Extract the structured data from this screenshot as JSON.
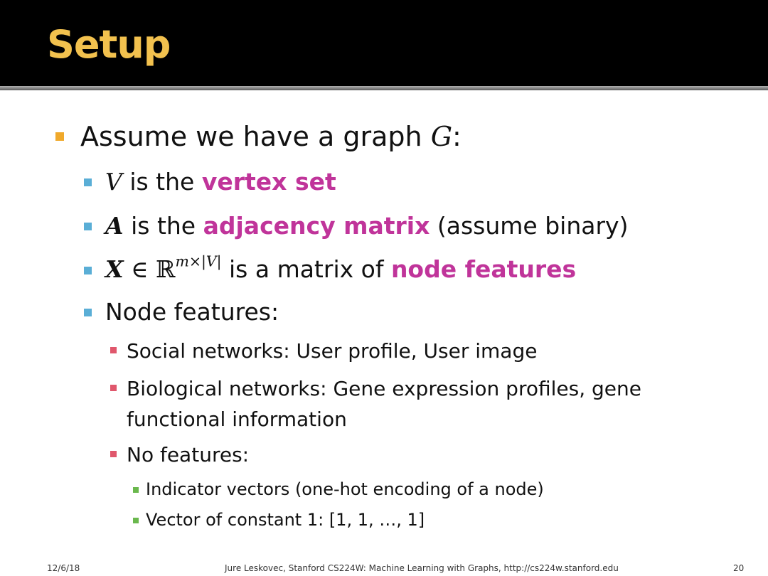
{
  "slide": {
    "title": "Setup",
    "lines": [
      {
        "text": "Assume we have a graph ",
        "math": "G",
        "tail": ":"
      },
      {
        "math": "V",
        "text": " is the ",
        "highlight": "vertex set"
      },
      {
        "math": "A",
        "text": " is the ",
        "highlight": "adjacency matrix",
        "tail": " (assume binary)"
      },
      {
        "math": "X",
        "op": " ∈ ",
        "set": "ℝ",
        "sup": "m×|V|",
        "text": " is a matrix of ",
        "highlight": "node features"
      },
      {
        "text": "Node features:"
      },
      {
        "text": "Social networks: User profile, User image"
      },
      {
        "text": "Biological networks: Gene expression profiles, gene"
      },
      {
        "text": "functional information"
      },
      {
        "text": "No features:"
      },
      {
        "text": "Indicator vectors (one-hot encoding of a node)"
      },
      {
        "text": "Vector of constant 1: [1, 1, …, 1]"
      }
    ],
    "bullet_colors": {
      "level1": "#f0a92b",
      "level2": "#5aaed6",
      "level3": "#e0576c",
      "level4": "#6ab84d"
    },
    "highlight_color": "#c0349a",
    "title_color": "#f2c14e"
  },
  "footer": {
    "date": "12/6/18",
    "center": "Jure Leskovec, Stanford CS224W: Machine Learning with Graphs, http://cs224w.stanford.edu",
    "page": "20"
  }
}
